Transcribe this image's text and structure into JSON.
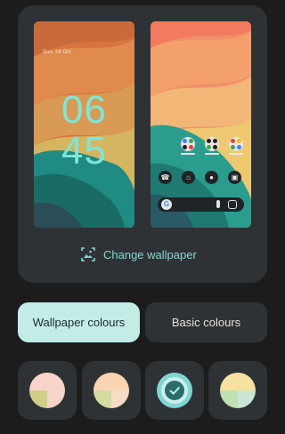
{
  "lock_screen": {
    "date": "Sun, 24 Oct",
    "clock_hours": "06",
    "clock_minutes": "45"
  },
  "home_screen": {
    "search_logo": "G",
    "dock": [
      "phone-icon",
      "home-icon",
      "maps-icon",
      "camera-icon"
    ],
    "app_groups": 3
  },
  "change_wallpaper": {
    "label": "Change wallpaper",
    "icon": "wallpaper-icon"
  },
  "tabs": [
    {
      "label": "Wallpaper colours",
      "selected": true
    },
    {
      "label": "Basic colours",
      "selected": false
    }
  ],
  "swatches": [
    {
      "colors": [
        "#f8d4c9",
        "#e0c0a6",
        "#cfcf8a",
        "#b8ddc9"
      ],
      "selected": false
    },
    {
      "colors": [
        "#fbd4b4",
        "#f2c7a4",
        "#d3dba1",
        "#c1e0c8"
      ],
      "selected": false
    },
    {
      "colors": [
        "#7fd6d3",
        "#4f9c9a",
        "#2d6b6b",
        "#a9e6e2"
      ],
      "selected": true
    },
    {
      "colors": [
        "#f6e1a0",
        "#f0c89a",
        "#bfe0b2",
        "#c9e5d6"
      ],
      "selected": false
    }
  ],
  "colors": {
    "accent": "#82d8cf",
    "selected_tab_bg": "#c3ece7",
    "card_bg": "#2f3234",
    "page_bg": "#1c1c1c"
  }
}
